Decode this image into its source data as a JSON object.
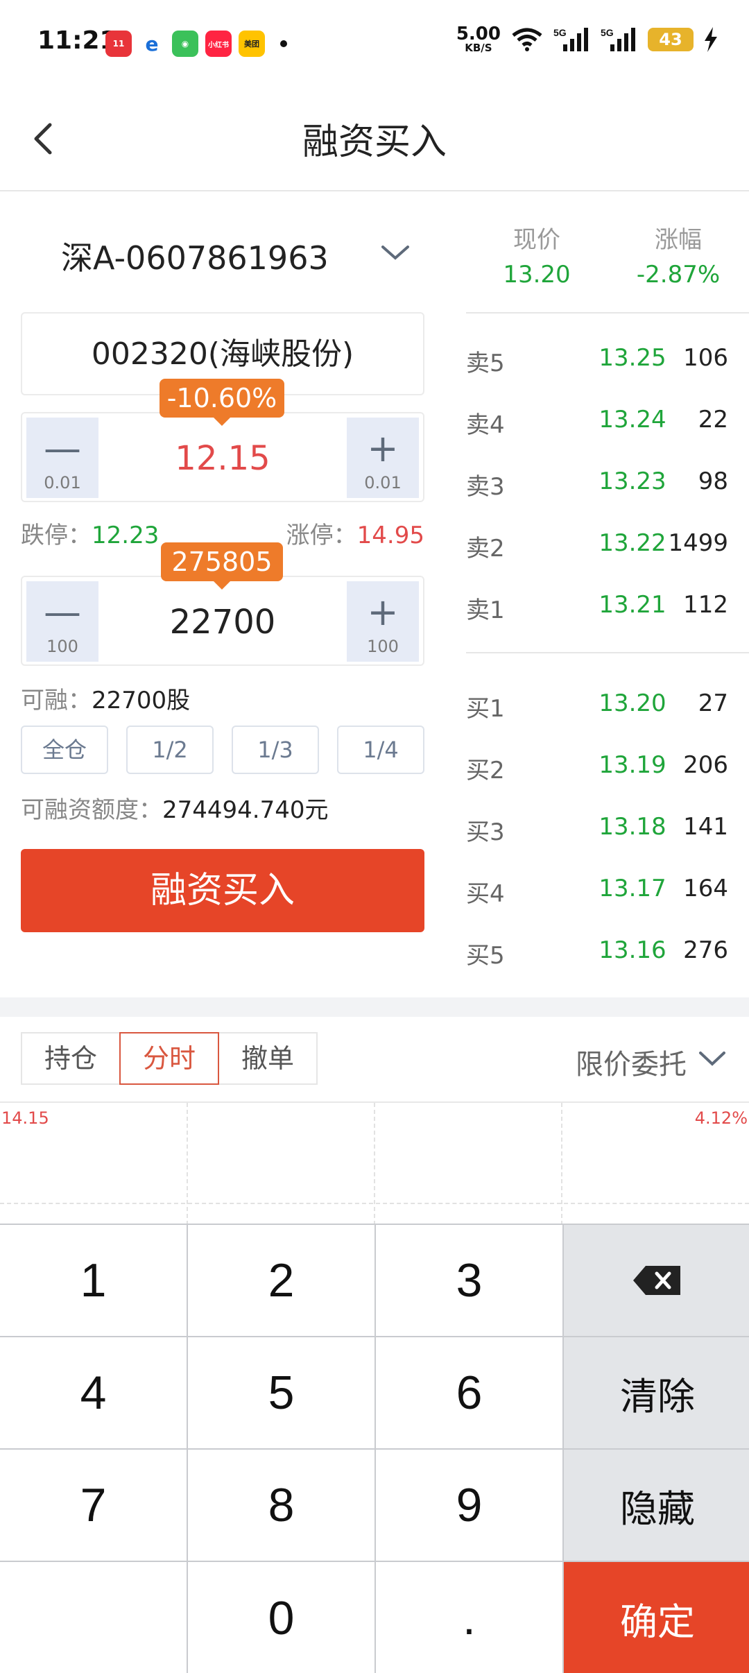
{
  "status_bar": {
    "time": "11:21",
    "net_speed": "5.00",
    "net_unit": "KB/S",
    "signal1": "5G",
    "signal2": "5G",
    "battery": "43",
    "app_icons": [
      "天猫 11.11",
      "中国电信",
      "微信",
      "小红书",
      "美团"
    ]
  },
  "header": {
    "title": "融资买入"
  },
  "account": {
    "label": "深A-0607861963"
  },
  "stock": {
    "code_name": "002320(海峡股份)"
  },
  "price": {
    "value": "12.15",
    "change_badge": "-10.60%",
    "step": "0.01",
    "limit_down_label": "跌停：",
    "limit_down": "12.23",
    "limit_up_label": "涨停：",
    "limit_up": "14.95"
  },
  "quantity": {
    "value": "22700",
    "amount_badge": "275805",
    "step": "100"
  },
  "available": {
    "label": "可融：",
    "value": "22700股"
  },
  "ratios": [
    "全仓",
    "1/2",
    "1/3",
    "1/4"
  ],
  "quota": {
    "label": "可融资额度：",
    "value": "274494.740元"
  },
  "buy_button": "融资买入",
  "quote": {
    "price_label": "现价",
    "price": "13.20",
    "change_label": "涨幅",
    "change": "-2.87%"
  },
  "sell_orders": [
    {
      "label": "卖5",
      "price": "13.25",
      "qty": "106"
    },
    {
      "label": "卖4",
      "price": "13.24",
      "qty": "22"
    },
    {
      "label": "卖3",
      "price": "13.23",
      "qty": "98"
    },
    {
      "label": "卖2",
      "price": "13.22",
      "qty": "1499"
    },
    {
      "label": "卖1",
      "price": "13.21",
      "qty": "112"
    }
  ],
  "buy_orders": [
    {
      "label": "买1",
      "price": "13.20",
      "qty": "27"
    },
    {
      "label": "买2",
      "price": "13.19",
      "qty": "206"
    },
    {
      "label": "买3",
      "price": "13.18",
      "qty": "141"
    },
    {
      "label": "买4",
      "price": "13.17",
      "qty": "164"
    },
    {
      "label": "买5",
      "price": "13.16",
      "qty": "276"
    }
  ],
  "tabs": [
    "持仓",
    "分时",
    "撤单"
  ],
  "active_tab": "分时",
  "order_type": "限价委托",
  "chart": {
    "top_price": "14.15",
    "top_pct": "4.12%"
  },
  "keypad": {
    "keys": [
      "1",
      "2",
      "3",
      "4",
      "5",
      "6",
      "7",
      "8",
      "9",
      "0",
      "."
    ],
    "clear": "清除",
    "hide": "隐藏",
    "confirm": "确定"
  },
  "colors": {
    "accent": "#e64528",
    "badge": "#ee7b2a",
    "up": "#e24a4a",
    "down": "#1fa53a",
    "stepper_bg": "#e6ebf6"
  }
}
